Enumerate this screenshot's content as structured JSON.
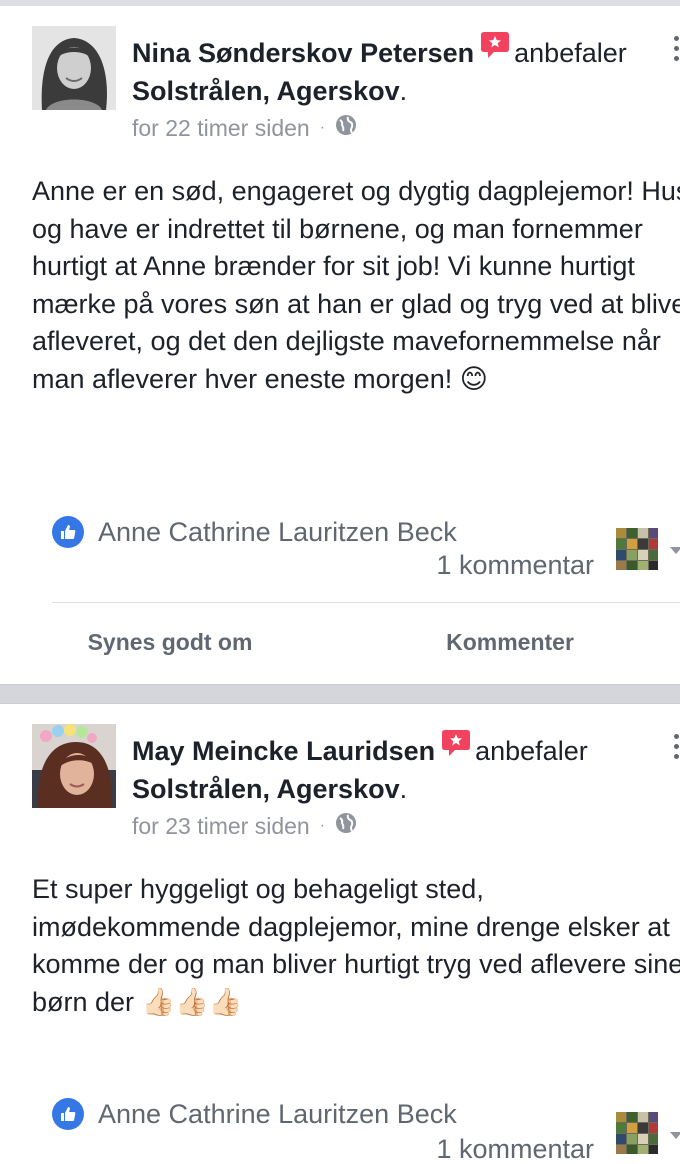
{
  "posts": [
    {
      "author": "Nina Sønderskov Petersen",
      "verb": "anbefaler",
      "page": "Solstrålen, Agerskov",
      "period": ".",
      "time": "for 22 timer siden",
      "dot": "·",
      "privacy_icon": "globe-icon",
      "text": "Anne er en sød, engageret og dygtig dagplejemor! Hus og have er indrettet til børnene, og man fornemmer hurtigt at Anne brænder for sit job! Vi kunne hurtigt mærke på vores søn at han er glad og tryg ved at blive afleveret, og det den dejligste mavefornemmelse når man afleverer hver eneste morgen! 😊",
      "liked_by": "Anne Cathrine Lauritzen Beck",
      "comments": "1 kommentar",
      "like_action": "Synes godt om",
      "comment_action": "Kommenter"
    },
    {
      "author": "May Meincke Lauridsen",
      "verb": "anbefaler",
      "page": "Solstrålen, Agerskov",
      "period": ".",
      "time": "for 23 timer siden",
      "dot": "·",
      "privacy_icon": "globe-icon",
      "text": "Et super hyggeligt og behageligt sted, imødekommende dagplejemor, mine drenge elsker at komme der og man bliver hurtigt tryg ved aflevere sine børn der 👍🏻👍🏻👍🏻",
      "liked_by": "Anne Cathrine Lauritzen Beck",
      "comments": "1 kommentar"
    }
  ],
  "colors": {
    "like_blue": "#3578e5",
    "badge_red": "#f3425f",
    "meta_gray": "#90949c",
    "action_gray": "#606770"
  }
}
